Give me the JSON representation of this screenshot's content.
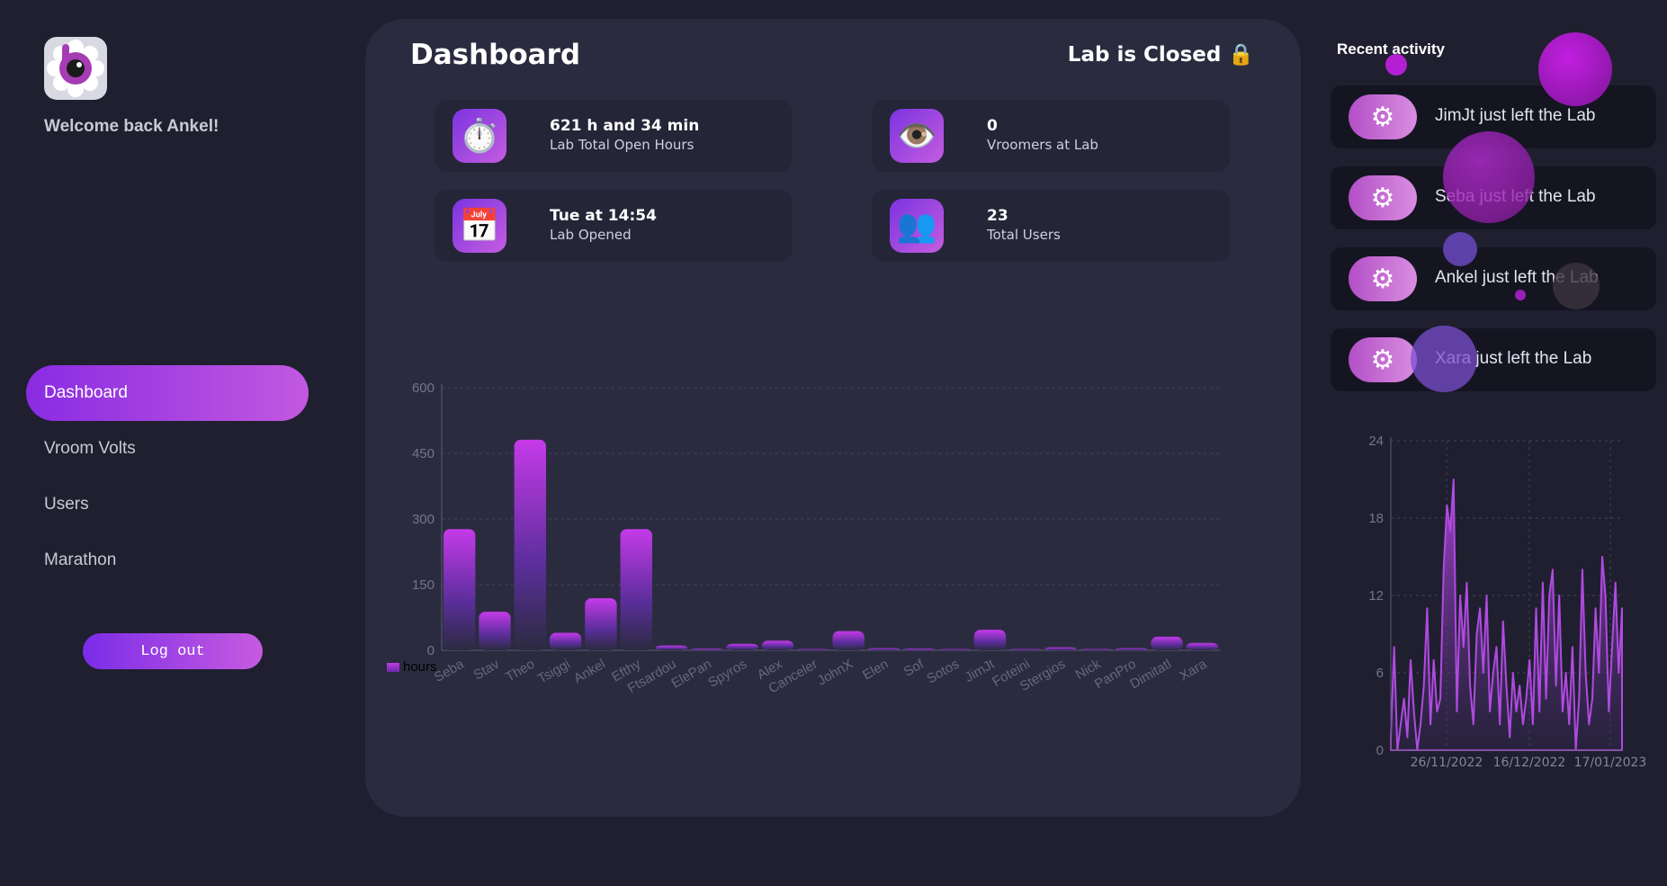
{
  "sidebar": {
    "welcome": "Welcome back Ankel!",
    "nav": [
      {
        "label": "Dashboard",
        "active": true
      },
      {
        "label": "Vroom Volts",
        "active": false
      },
      {
        "label": "Users",
        "active": false
      },
      {
        "label": "Marathon",
        "active": false
      }
    ],
    "logout_label": "Log out"
  },
  "main": {
    "title": "Dashboard",
    "lab_status": "Lab is Closed 🔒",
    "stats": [
      {
        "icon": "stopwatch-icon",
        "glyph": "⏱️",
        "value": "621 h and 34 min",
        "label": "Lab Total Open Hours"
      },
      {
        "icon": "eye-icon",
        "glyph": "👁️",
        "value": "0",
        "label": "Vroomers at Lab"
      },
      {
        "icon": "calendar-icon",
        "glyph": "📅",
        "value": "Tue at 14:54",
        "label": "Lab Opened"
      },
      {
        "icon": "users-icon",
        "glyph": "👥",
        "value": "23",
        "label": "Total Users"
      }
    ]
  },
  "recent": {
    "title": "Recent activity",
    "items": [
      {
        "text": "JimJt just left the Lab"
      },
      {
        "text": "Seba just left the Lab"
      },
      {
        "text": "Ankel just left the Lab"
      },
      {
        "text": "Xara just left the Lab"
      }
    ]
  },
  "colors": {
    "accent": "#8a2be2",
    "accent2": "#c259df",
    "bg": "#1f1f30",
    "panel": "#2b2b40"
  },
  "chart_data": [
    {
      "type": "bar",
      "categories": [
        "Seba",
        "Stav",
        "Theo",
        "Tsiggi",
        "Ankel",
        "Efthy",
        "Ftsardou",
        "ElePan",
        "Spyros",
        "Alex",
        "Canceler",
        "JohnX",
        "Elen",
        "Sof",
        "Sotos",
        "JimJt",
        "Foteini",
        "Stergios",
        "Nick",
        "PanPro",
        "Dimitatl",
        "Xara"
      ],
      "series": [
        {
          "name": "hours",
          "values": [
            277,
            88,
            481,
            40,
            119,
            277,
            11,
            4,
            15,
            22,
            1,
            44,
            5,
            4,
            2,
            47,
            1,
            7,
            1,
            5,
            31,
            17
          ]
        }
      ],
      "ylim": [
        0,
        600
      ],
      "yticks": [
        0,
        150,
        300,
        450,
        600
      ],
      "grid": true,
      "legend": "bottom-left"
    },
    {
      "type": "area",
      "ylim": [
        0,
        24
      ],
      "yticks": [
        0,
        6,
        12,
        18,
        24
      ],
      "xticks": [
        "26/11/2022",
        "16/12/2022",
        "17/01/2023"
      ],
      "grid": true,
      "values": [
        1,
        8,
        0,
        2,
        4,
        1,
        7,
        3,
        0,
        2,
        5,
        11,
        2,
        7,
        3,
        4,
        14,
        19,
        17,
        21,
        3,
        12,
        8,
        13,
        5,
        2,
        9,
        11,
        6,
        12,
        3,
        6,
        8,
        2,
        10,
        5,
        1,
        6,
        3,
        5,
        2,
        4,
        7,
        2,
        11,
        3,
        13,
        4,
        12,
        14,
        5,
        12,
        3,
        6,
        2,
        8,
        0,
        4,
        14,
        6,
        2,
        4,
        11,
        6,
        15,
        12,
        3,
        8,
        13,
        6,
        11
      ]
    }
  ]
}
